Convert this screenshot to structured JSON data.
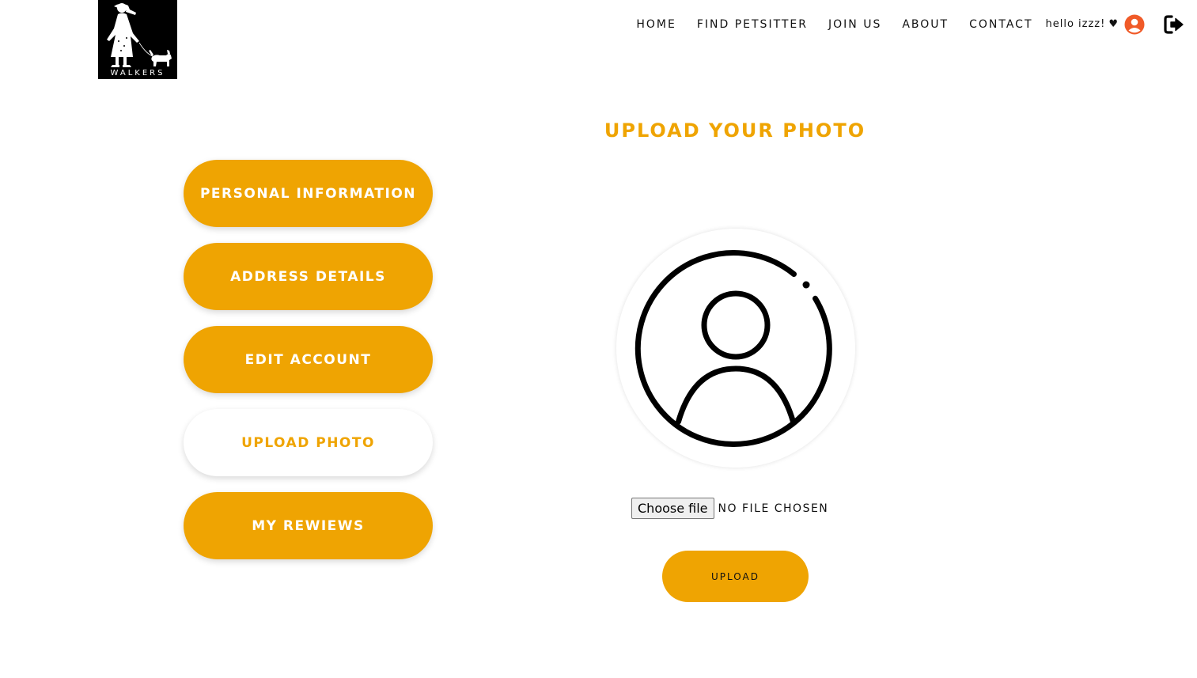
{
  "logo": {
    "text": "WALKERS",
    "icon": "walker-with-dog-logo"
  },
  "nav": {
    "items": [
      {
        "label": "HOME"
      },
      {
        "label": "FIND PETSITTER"
      },
      {
        "label": "JOIN US"
      },
      {
        "label": "ABOUT"
      },
      {
        "label": "CONTACT"
      }
    ],
    "greeting": "hello izzz!",
    "heart": "♥",
    "user_icon": "user-circle-icon",
    "logout_icon": "sign-out-icon"
  },
  "sidebar": {
    "items": [
      {
        "label": "PERSONAL INFORMATION",
        "active": false
      },
      {
        "label": "ADDRESS DETAILS",
        "active": false
      },
      {
        "label": "EDIT ACCOUNT",
        "active": false
      },
      {
        "label": "UPLOAD PHOTO",
        "active": true
      },
      {
        "label": "MY REWIEWS",
        "active": false
      }
    ]
  },
  "main": {
    "title": "UPLOAD YOUR PHOTO",
    "avatar_icon": "default-avatar-icon",
    "file_input": {
      "button_label": "Choose file",
      "status": "NO FILE CHOSEN"
    },
    "upload_label": "UPLOAD"
  },
  "colors": {
    "accent": "#efa402",
    "user_icon": "#f05a28",
    "text": "#111111"
  }
}
